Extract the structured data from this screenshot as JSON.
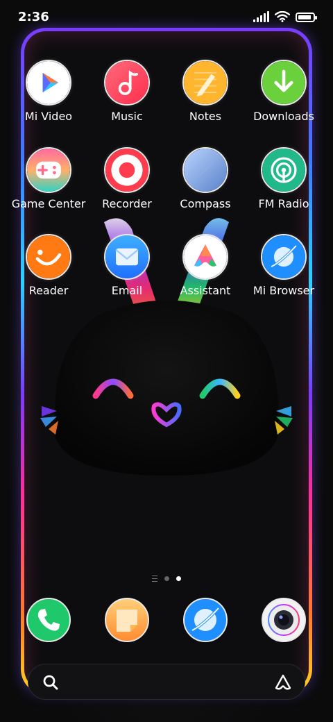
{
  "status_bar": {
    "time": "2:36",
    "battery_level": 0.9
  },
  "apps": [
    {
      "label": "Mi Video",
      "icon": "mi-video-icon"
    },
    {
      "label": "Music",
      "icon": "music-icon"
    },
    {
      "label": "Notes",
      "icon": "notes-icon"
    },
    {
      "label": "Downloads",
      "icon": "downloads-icon"
    },
    {
      "label": "Game Center",
      "icon": "game-center-icon"
    },
    {
      "label": "Recorder",
      "icon": "recorder-icon"
    },
    {
      "label": "Compass",
      "icon": "compass-icon"
    },
    {
      "label": "FM Radio",
      "icon": "fm-radio-icon"
    },
    {
      "label": "Reader",
      "icon": "reader-icon"
    },
    {
      "label": "Email",
      "icon": "email-icon"
    },
    {
      "label": "Assistant",
      "icon": "assistant-icon"
    },
    {
      "label": "Mi Browser",
      "icon": "mi-browser-icon"
    }
  ],
  "dock": [
    {
      "icon": "phone-icon"
    },
    {
      "icon": "messages-icon"
    },
    {
      "icon": "browser-icon"
    },
    {
      "icon": "camera-icon"
    }
  ],
  "pager": {
    "pages": 2,
    "active": 2
  },
  "search": {
    "icon": "search-icon",
    "assistant_icon": "assistant-logo-icon"
  },
  "colors": {
    "frame_top": "#7a3bff",
    "frame_bottom": "#ffd21e",
    "background": "#0d0d0f"
  }
}
